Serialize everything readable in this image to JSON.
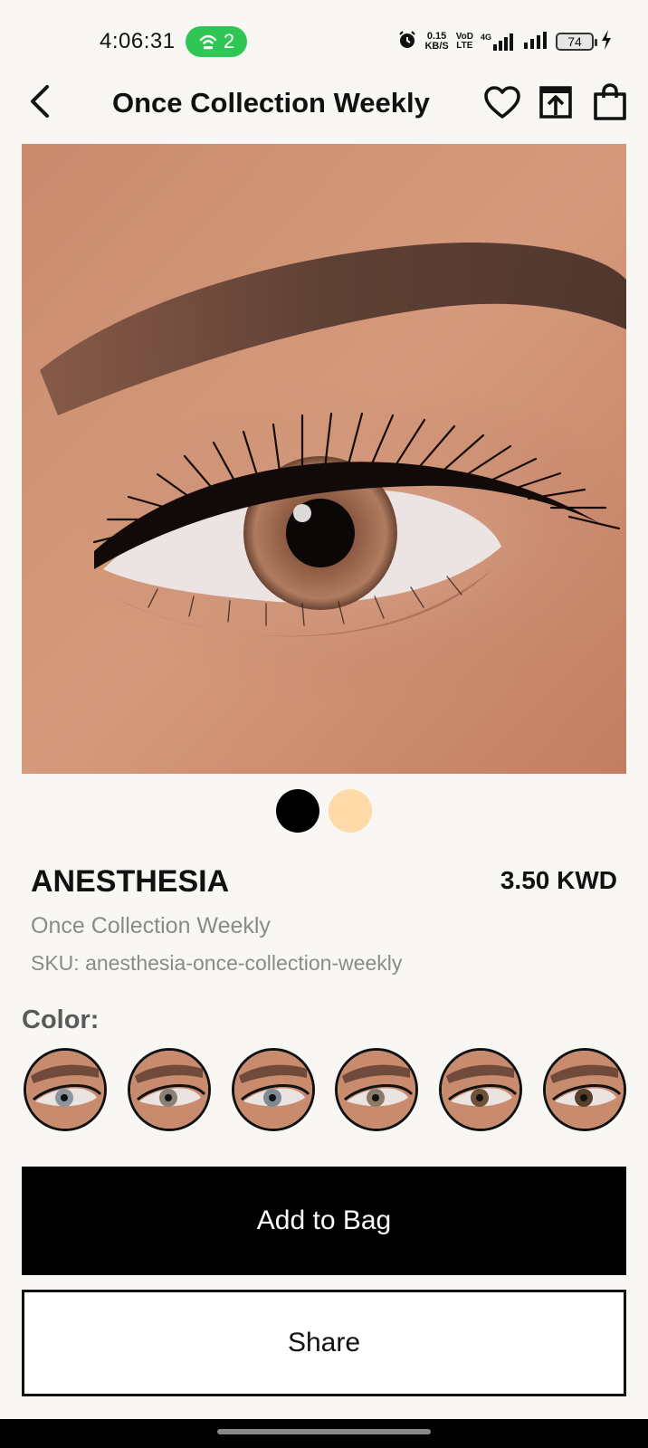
{
  "status_bar": {
    "time": "4:06:31",
    "hotspot_count": "2",
    "net_speed_value": "0.15",
    "net_speed_unit": "KB/S",
    "volte_top": "VoD",
    "volte_bottom": "LTE",
    "network": "4G",
    "battery": "74"
  },
  "header": {
    "title": "Once Collection Weekly"
  },
  "colors": {
    "accent_black": "#000000",
    "dot_active": "#000000",
    "dot_secondary": "#ffd9a8",
    "muted_text": "#8a8a8a"
  },
  "gallery": {
    "dots": [
      "active",
      "inactive"
    ]
  },
  "product": {
    "name": "ANESTHESIA",
    "price": "3.50 KWD",
    "collection": "Once Collection Weekly",
    "sku": "SKU: anesthesia-once-collection-weekly"
  },
  "color_section": {
    "label": "Color:",
    "swatches": [
      {
        "iris": "#8c949c"
      },
      {
        "iris": "#8a8074"
      },
      {
        "iris": "#7e8a96"
      },
      {
        "iris": "#8a7a66"
      },
      {
        "iris": "#6e5238"
      },
      {
        "iris": "#5a3e2c"
      }
    ]
  },
  "actions": {
    "add_to_bag": "Add to Bag",
    "share": "Share"
  }
}
